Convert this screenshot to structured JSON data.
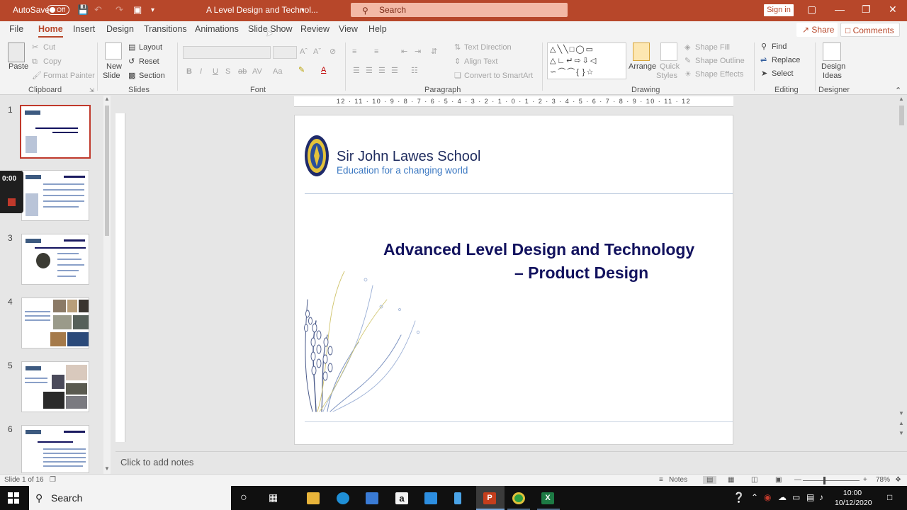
{
  "titlebar": {
    "autosave_label": "AutoSave",
    "autosave_state": "Off",
    "doc_title": "A Level Design and Technol...",
    "search_placeholder": "Search",
    "sign_in": "Sign in"
  },
  "tabs": [
    "File",
    "Home",
    "Insert",
    "Design",
    "Transitions",
    "Animations",
    "Slide Show",
    "Review",
    "View",
    "Help"
  ],
  "active_tab": "Home",
  "share_label": "Share",
  "comments_label": "Comments",
  "ribbon": {
    "clipboard": {
      "paste": "Paste",
      "cut": "Cut",
      "copy": "Copy",
      "format_painter": "Format Painter",
      "group": "Clipboard"
    },
    "slides": {
      "new_slide_1": "New",
      "new_slide_2": "Slide",
      "layout": "Layout",
      "reset": "Reset",
      "section": "Section",
      "group": "Slides"
    },
    "font": {
      "group": "Font"
    },
    "paragraph": {
      "text_direction": "Text Direction",
      "align_text": "Align Text",
      "convert_smartart": "Convert to SmartArt",
      "group": "Paragraph"
    },
    "drawing": {
      "arrange": "Arrange",
      "quick_styles_1": "Quick",
      "quick_styles_2": "Styles",
      "shape_fill": "Shape Fill",
      "shape_outline": "Shape Outline",
      "shape_effects": "Shape Effects",
      "group": "Drawing"
    },
    "editing": {
      "find": "Find",
      "replace": "Replace",
      "select": "Select",
      "group": "Editing"
    },
    "designer": {
      "ideas_1": "Design",
      "ideas_2": "Ideas",
      "group": "Designer"
    }
  },
  "thumbnails": [
    {
      "number": "1",
      "selected": true
    },
    {
      "number": "2",
      "selected": false
    },
    {
      "number": "3",
      "selected": false
    },
    {
      "number": "4",
      "selected": false
    },
    {
      "number": "5",
      "selected": false
    },
    {
      "number": "6",
      "selected": false
    }
  ],
  "recording": {
    "time": "0:00"
  },
  "ruler_text": "12 · 11 · 10 · 9 · 8 · 7 · 6 · 5 · 4 · 3 · 2 · 1 · 0 · 1 · 2 · 3 · 4 · 5 · 6 · 7 · 8 · 9 · 10 · 11 · 12",
  "slide": {
    "school_name": "Sir John Lawes School",
    "motto": "Education for a changing world",
    "title_line1": "Advanced Level Design and Technology",
    "title_line2": "– Product Design"
  },
  "notes_placeholder": "Click to add notes",
  "status": {
    "slide_count": "Slide 1 of 16",
    "notes": "Notes",
    "zoom": "78%"
  },
  "taskbar": {
    "search_placeholder": "Search",
    "time": "10:00",
    "date": "10/12/2020"
  }
}
